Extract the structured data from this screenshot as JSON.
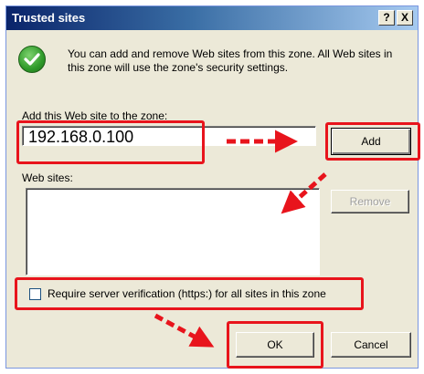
{
  "dialog": {
    "title": "Trusted sites",
    "help_glyph": "?",
    "close_glyph": "X",
    "info_text": "You can add and remove Web sites from this zone. All Web sites in this zone will use the zone's security settings.",
    "zone_label": "Add this Web site to the zone:",
    "zone_input_value": "192.168.0.100",
    "add_label": "Add",
    "sites_label": "Web sites:",
    "sites": [],
    "remove_label": "Remove",
    "remove_enabled": false,
    "https_checkbox_checked": false,
    "https_checkbox_label": "Require server verification (https:) for all sites in this zone",
    "ok_label": "OK",
    "cancel_label": "Cancel"
  },
  "icons": {
    "info": "green-checkmark-icon",
    "help": "question-mark-icon",
    "close": "close-x-icon"
  },
  "annotations": {
    "highlight_color": "#e8141c"
  }
}
